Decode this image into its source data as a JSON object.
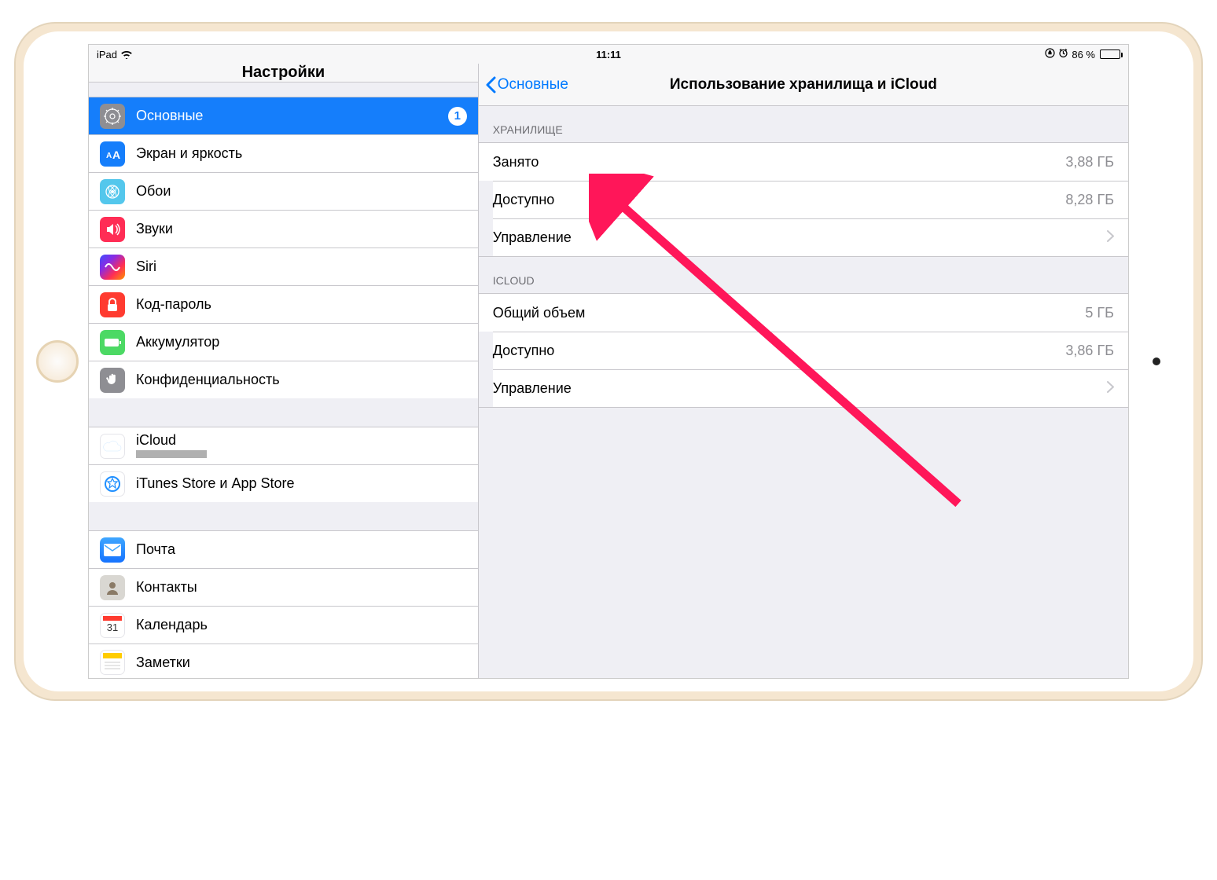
{
  "statusbar": {
    "device": "iPad",
    "time": "11:11",
    "battery_text": "86 %",
    "battery_percent": 86
  },
  "sidebar": {
    "title": "Настройки",
    "groups": [
      {
        "items": [
          {
            "id": "general",
            "label": "Основные",
            "badge": "1",
            "selected": true,
            "icon": "gear-icon"
          },
          {
            "id": "display",
            "label": "Экран и яркость",
            "icon": "text-size-icon"
          },
          {
            "id": "wallpaper",
            "label": "Обои",
            "icon": "wallpaper-icon"
          },
          {
            "id": "sounds",
            "label": "Звуки",
            "icon": "sounds-icon"
          },
          {
            "id": "siri",
            "label": "Siri",
            "icon": "siri-icon"
          },
          {
            "id": "passcode",
            "label": "Код-пароль",
            "icon": "lock-icon"
          },
          {
            "id": "battery",
            "label": "Аккумулятор",
            "icon": "battery-icon"
          },
          {
            "id": "privacy",
            "label": "Конфиденциальность",
            "icon": "hand-icon"
          }
        ]
      },
      {
        "items": [
          {
            "id": "icloud",
            "label": "iCloud",
            "subtitle_redacted": true,
            "icon": "icloud-icon"
          },
          {
            "id": "itunes",
            "label": "iTunes Store и App Store",
            "icon": "appstore-icon"
          }
        ]
      },
      {
        "items": [
          {
            "id": "mail",
            "label": "Почта",
            "icon": "mail-icon"
          },
          {
            "id": "contacts",
            "label": "Контакты",
            "icon": "contacts-icon"
          },
          {
            "id": "calendar",
            "label": "Календарь",
            "icon": "calendar-icon"
          },
          {
            "id": "notes",
            "label": "Заметки",
            "icon": "notes-icon"
          }
        ]
      }
    ]
  },
  "main": {
    "back_label": "Основные",
    "title": "Использование хранилища и iCloud",
    "sections": [
      {
        "header": "ХРАНИЛИЩЕ",
        "rows": [
          {
            "label": "Занято",
            "value": "3,88 ГБ"
          },
          {
            "label": "Доступно",
            "value": "8,28 ГБ"
          },
          {
            "label": "Управление",
            "chevron": true,
            "interactable": true
          }
        ]
      },
      {
        "header": "ICLOUD",
        "rows": [
          {
            "label": "Общий объем",
            "value": "5 ГБ"
          },
          {
            "label": "Доступно",
            "value": "3,86 ГБ"
          },
          {
            "label": "Управление",
            "chevron": true,
            "interactable": true
          }
        ]
      }
    ]
  }
}
